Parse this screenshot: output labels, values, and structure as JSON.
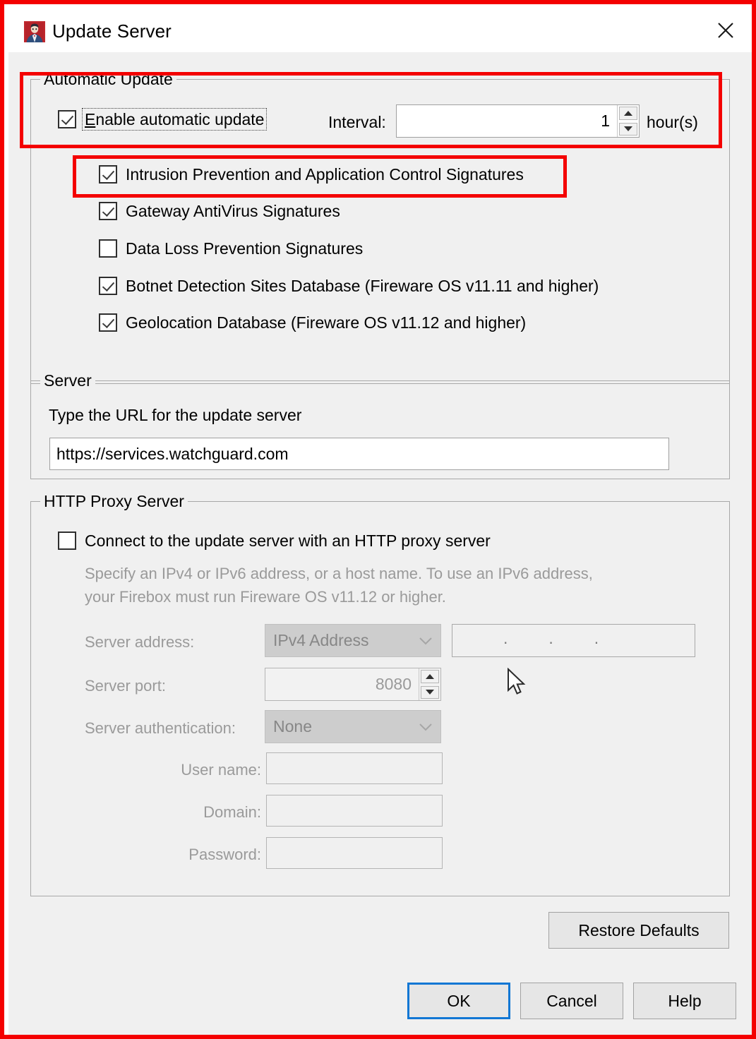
{
  "window": {
    "title": "Update Server",
    "icon": "watchguard-app-icon",
    "close_icon": "close-icon"
  },
  "automatic_update": {
    "group_title": "Automatic Update",
    "enable_checkbox": {
      "label": "Enable automatic update",
      "accel": "E",
      "rest": "nable automatic update",
      "checked": true,
      "focused": true
    },
    "interval_label": "Interval:",
    "interval_value": "1",
    "interval_units": "hour(s)",
    "signature_items": [
      {
        "label": "Intrusion Prevention and Application Control Signatures",
        "checked": true
      },
      {
        "label": "Gateway AntiVirus Signatures",
        "checked": true
      },
      {
        "label": "Data Loss Prevention Signatures",
        "checked": false
      },
      {
        "label": "Botnet Detection Sites Database (Fireware OS v11.11 and higher)",
        "checked": true
      },
      {
        "label": "Geolocation Database (Fireware OS v11.12 and higher)",
        "checked": true
      }
    ]
  },
  "server": {
    "group_title": "Server",
    "instruction": "Type the URL for the update server",
    "url_value": "https://services.watchguard.com",
    "url_placeholder": ""
  },
  "http_proxy": {
    "group_title": "HTTP Proxy Server",
    "connect_checkbox": {
      "label": "Connect to the update server with an HTTP proxy server",
      "checked": false
    },
    "hint_line1": "Specify an IPv4 or IPv6 address, or a host name. To use an IPv6 address,",
    "hint_line2": "your Firebox must run Fireware OS v11.12 or higher.",
    "fields": {
      "server_address_label": "Server address:",
      "server_address_type": "IPv4 Address",
      "ip_dots": [
        ".",
        ".",
        "."
      ],
      "server_port_label": "Server port:",
      "server_port_value": "8080",
      "server_auth_label": "Server authentication:",
      "server_auth_value": "None",
      "user_name_label": "User name:",
      "user_name_value": "",
      "domain_label": "Domain:",
      "domain_value": "",
      "password_label": "Password:",
      "password_value": ""
    }
  },
  "buttons": {
    "restore_defaults": "Restore Defaults",
    "ok": "OK",
    "cancel": "Cancel",
    "help": "Help"
  },
  "colors": {
    "annotation": "#f40000",
    "dialog_bg": "#f0f0f0",
    "default_button_focus": "#1277d4",
    "disabled_text": "#9a9a9a"
  }
}
